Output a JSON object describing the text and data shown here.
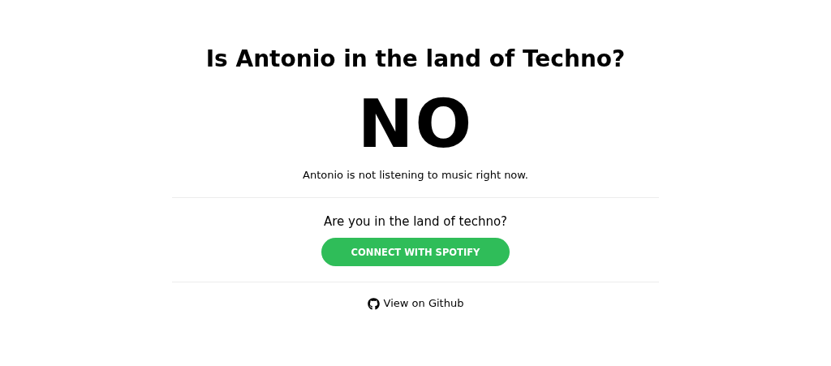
{
  "title": "Is Antonio in the land of Techno?",
  "answer": "NO",
  "status": "Antonio is not listening to music right now.",
  "question": "Are you in the land of techno?",
  "connect_button": "CONNECT WITH SPOTIFY",
  "github_link": "View on Github"
}
